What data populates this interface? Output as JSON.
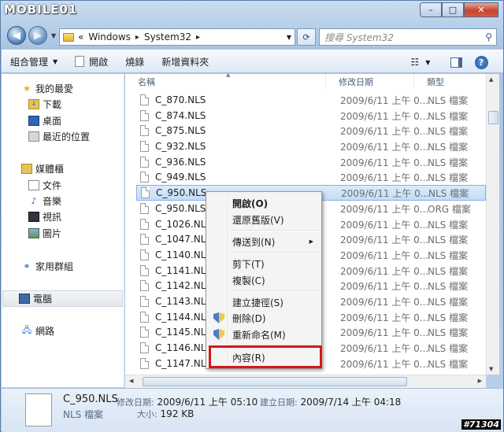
{
  "watermark": "MOBILE01",
  "window": {
    "min": "–",
    "max": "□",
    "close": "✕"
  },
  "nav": {
    "back": "◀",
    "forward": "▶",
    "history": "▼"
  },
  "address": {
    "prefix": "«",
    "crumbs": [
      "Windows",
      "System32"
    ],
    "sep": "▸"
  },
  "search": {
    "placeholder": "搜尋 System32"
  },
  "toolbar": {
    "organize": "組合管理",
    "open": "開啟",
    "burn": "燒錄",
    "new_folder": "新增資料夾",
    "help": "?"
  },
  "sidebar": {
    "favorites": "我的最愛",
    "downloads": "下載",
    "desktop": "桌面",
    "recent": "最近的位置",
    "libraries": "媒體櫃",
    "documents": "文件",
    "music": "音樂",
    "videos": "視訊",
    "pictures": "圖片",
    "homegroup": "家用群組",
    "computer": "電腦",
    "network": "網路"
  },
  "columns": {
    "name": "名稱",
    "date": "修改日期",
    "type": "類型"
  },
  "files": [
    {
      "name": "C_870.NLS",
      "date": "2009/6/11 上午 0...",
      "type": "NLS 檔案"
    },
    {
      "name": "C_874.NLS",
      "date": "2009/6/11 上午 0...",
      "type": "NLS 檔案"
    },
    {
      "name": "C_875.NLS",
      "date": "2009/6/11 上午 0...",
      "type": "NLS 檔案"
    },
    {
      "name": "C_932.NLS",
      "date": "2009/6/11 上午 0...",
      "type": "NLS 檔案"
    },
    {
      "name": "C_936.NLS",
      "date": "2009/6/11 上午 0...",
      "type": "NLS 檔案"
    },
    {
      "name": "C_949.NLS",
      "date": "2009/6/11 上午 0...",
      "type": "NLS 檔案"
    },
    {
      "name": "C_950.NLS",
      "date": "2009/6/11 上午 0...",
      "type": "NLS 檔案"
    },
    {
      "name": "C_950.NLS.o",
      "date": "2009/6/11 上午 0...",
      "type": "ORG 檔案"
    },
    {
      "name": "C_1026.NLS",
      "date": "2009/6/11 上午 0...",
      "type": "NLS 檔案"
    },
    {
      "name": "C_1047.NLS",
      "date": "2009/6/11 上午 0...",
      "type": "NLS 檔案"
    },
    {
      "name": "C_1140.NLS",
      "date": "2009/6/11 上午 0...",
      "type": "NLS 檔案"
    },
    {
      "name": "C_1141.NLS",
      "date": "2009/6/11 上午 0...",
      "type": "NLS 檔案"
    },
    {
      "name": "C_1142.NLS",
      "date": "2009/6/11 上午 0...",
      "type": "NLS 檔案"
    },
    {
      "name": "C_1143.NLS",
      "date": "2009/6/11 上午 0...",
      "type": "NLS 檔案"
    },
    {
      "name": "C_1144.NLS",
      "date": "2009/6/11 上午 0...",
      "type": "NLS 檔案"
    },
    {
      "name": "C_1145.NLS",
      "date": "2009/6/11 上午 0...",
      "type": "NLS 檔案"
    },
    {
      "name": "C_1146.NLS",
      "date": "2009/6/11 上午 0...",
      "type": "NLS 檔案"
    },
    {
      "name": "C_1147.NLS",
      "date": "2009/6/11 上午 0...",
      "type": "NLS 檔案"
    }
  ],
  "context_menu": {
    "open": "開啟(O)",
    "restore": "還原舊版(V)",
    "send_to": "傳送到(N)",
    "cut": "剪下(T)",
    "copy": "複製(C)",
    "shortcut": "建立捷徑(S)",
    "delete": "刪除(D)",
    "rename": "重新命名(M)",
    "properties": "內容(R)"
  },
  "details": {
    "filename": "C_950.NLS",
    "modified_label": "修改日期:",
    "modified": "2009/6/11 上午 05:10",
    "created_label": "建立日期:",
    "created": "2009/7/14 上午 04:18",
    "type": "NLS 檔案",
    "size_label": "大小:",
    "size": "192 KB"
  },
  "image_id": "#71304",
  "colors": {
    "highlight": "#d6171b",
    "selection": "#c4ddf7"
  }
}
